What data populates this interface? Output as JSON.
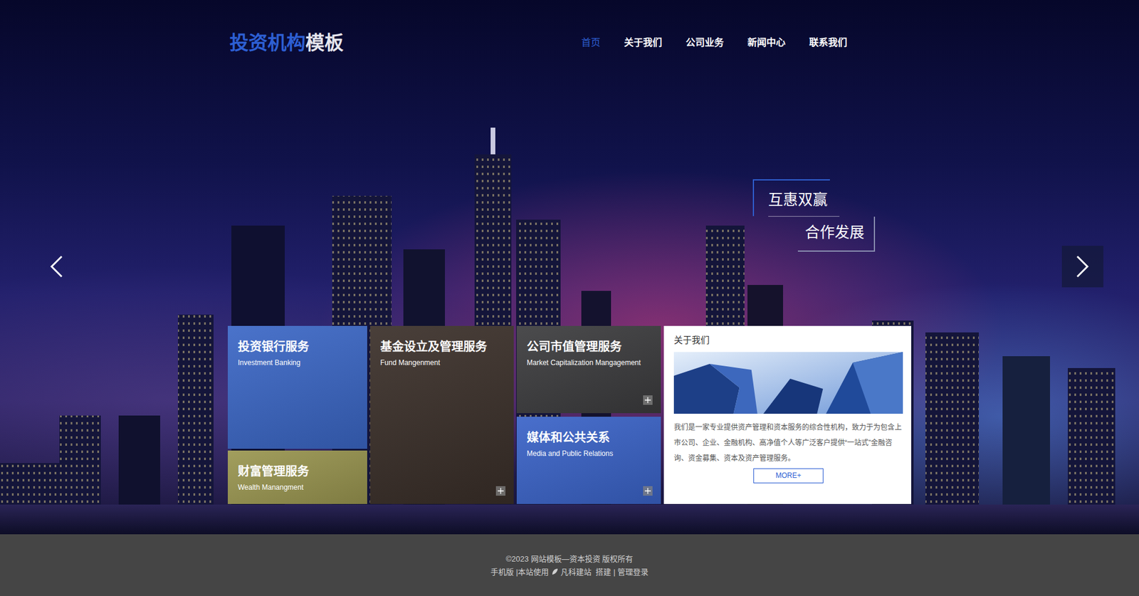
{
  "logo": {
    "primary": "投资机构",
    "secondary": "模板"
  },
  "nav": [
    {
      "label": "首页",
      "selected": true
    },
    {
      "label": "关于我们",
      "selected": false
    },
    {
      "label": "公司业务",
      "selected": false
    },
    {
      "label": "新闻中心",
      "selected": false
    },
    {
      "label": "联系我们",
      "selected": false
    }
  ],
  "slide": {
    "caption": [
      "互惠双赢",
      "合作发展"
    ]
  },
  "service_columns": [
    {
      "tiles": [
        {
          "title": "投资银行服务",
          "subtitle": "Investment Banking",
          "kind": "plain",
          "color": "#3b67c6"
        },
        {
          "title": "财富管理服务",
          "subtitle": "Wealth Manangment",
          "kind": "plain",
          "color": "#9a9650"
        }
      ]
    },
    {
      "tiles": [
        {
          "title": "基金设立及管理服务",
          "subtitle": "Fund Mangenment",
          "kind": "plus",
          "color": "#3a2f29"
        }
      ]
    },
    {
      "tiles": [
        {
          "title": "公司市值管理服务",
          "subtitle": "Market Capitalization Mangagement",
          "kind": "plus",
          "color": "#3c3c3e"
        },
        {
          "title": "媒体和公共关系",
          "subtitle": "Media and Public Relations",
          "kind": "plus",
          "color": "#3a63c8"
        }
      ]
    }
  ],
  "about": {
    "title": "关于我们",
    "text": "我们是一家专业提供资产管理和资本服务的综合性机构，致力于为包含上市公司、企业、金融机构、高净值个人等广泛客户提供“一站式”金融咨询、资金募集、资本及资产管理服务。",
    "button": "MORE+"
  },
  "footer": {
    "copyright": "©2023 网站模板—资本投资 版权所有",
    "mobile": "手机版",
    "powered": "|本站使用",
    "brand": "凡科建站",
    "built": "搭建",
    "sep": "|",
    "admin": "管理登录"
  }
}
